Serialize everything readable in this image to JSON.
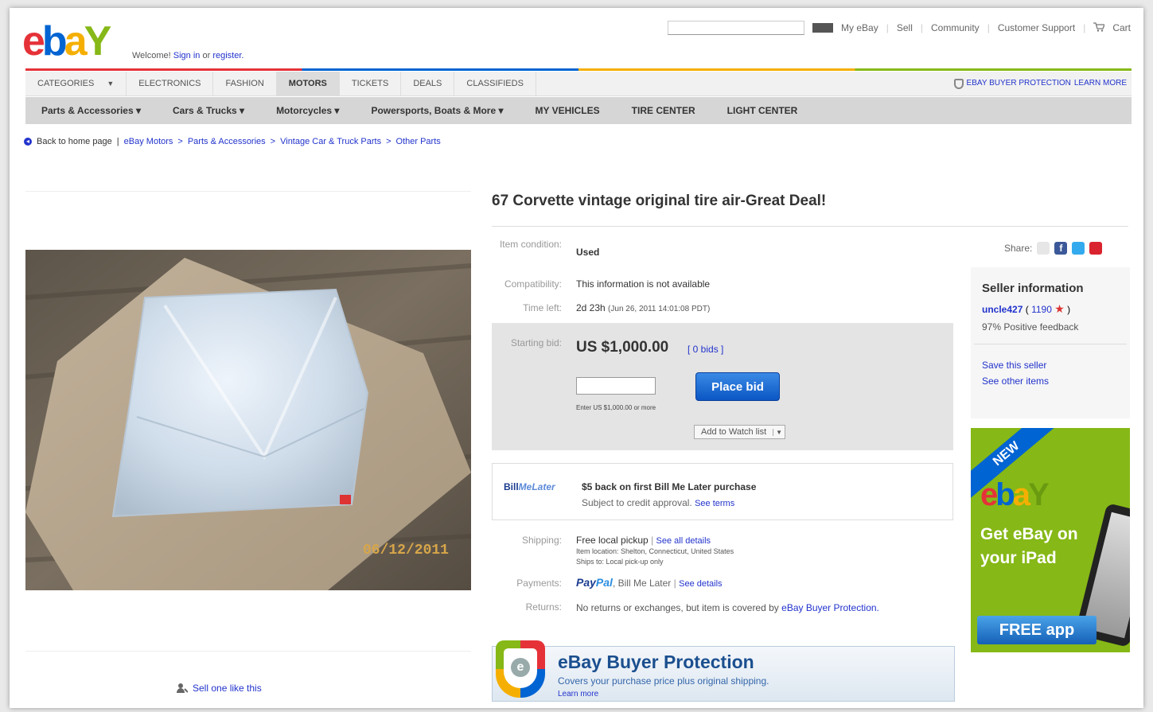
{
  "header": {
    "logo_letters": [
      "e",
      "b",
      "a",
      "Y"
    ],
    "welcome": "Welcome!",
    "sign_in": "Sign in",
    "or": "or",
    "register": "register.",
    "topnav": [
      "My eBay",
      "Sell",
      "Community",
      "Customer Support",
      "Cart"
    ]
  },
  "tabs": [
    "CATEGORIES",
    "ELECTRONICS",
    "FASHION",
    "MOTORS",
    "TICKETS",
    "DEALS",
    "CLASSIFIEDS"
  ],
  "active_tab": "MOTORS",
  "buyer_protection_top": "eBay Buyer Protection",
  "learn_more_top": "Learn more",
  "subnav": [
    "Parts & Accessories ▾",
    "Cars & Trucks ▾",
    "Motorcycles ▾",
    "Powersports, Boats & More ▾",
    "MY VEHICLES",
    "TIRE CENTER",
    "LIGHT CENTER"
  ],
  "breadcrumb": {
    "back": "Back to home page",
    "sep": "|",
    "path": [
      "eBay Motors",
      "Parts & Accessories",
      "Vintage Car & Truck Parts",
      "Other Parts"
    ]
  },
  "photo": {
    "date_stamp": "06/12/2011"
  },
  "sell_one": "Sell one like this",
  "item": {
    "title": "67 Corvette vintage original tire air-Great Deal!",
    "condition_label": "Item condition:",
    "condition": "Used",
    "compat_label": "Compatibility:",
    "compat": "This information is not available",
    "time_left_label": "Time left:",
    "time_left": "2d 23h",
    "time_left_detail": "(Jun 26, 2011 14:01:08 PDT)"
  },
  "bid": {
    "label": "Starting bid:",
    "price": "US $1,000.00",
    "bids_link": "[ 0 bids ]",
    "place_bid": "Place bid",
    "enter_hint": "Enter US $1,000.00 or more",
    "watch": "Add to Watch list"
  },
  "bill_me_later": {
    "logo_a": "Bill",
    "logo_b": "MeLater",
    "offer": "$5 back on first Bill Me Later purchase",
    "subject": "Subject to credit approval.",
    "see_terms": "See terms"
  },
  "shipping": {
    "label": "Shipping:",
    "value": "Free local pickup",
    "see_details": "See all details",
    "location": "Item location: Shelton, Connecticut, United States",
    "ships_to": "Ships to: Local pick-up only"
  },
  "payments": {
    "label": "Payments:",
    "paypal_a": "Pay",
    "paypal_b": "Pal",
    "bml": ", Bill Me Later",
    "see_details": "See details"
  },
  "returns": {
    "label": "Returns:",
    "text": "No returns or exchanges, but item is covered by",
    "link": "eBay Buyer Protection."
  },
  "protection_banner": {
    "title": "eBay Buyer Protection",
    "sub": "Covers your purchase price plus original shipping.",
    "learn": "Learn more"
  },
  "share_label": "Share:",
  "seller": {
    "heading": "Seller information",
    "name": "uncle427",
    "feedback_open": "(",
    "feedback_count": "1190",
    "feedback_close": ")",
    "positive": "97% Positive feedback",
    "save": "Save this seller",
    "see_other": "See other items"
  },
  "ad": {
    "ribbon": "NEW",
    "line1": "Get eBay on",
    "line2": "your iPad",
    "cta": "FREE app"
  },
  "colors": {
    "ebay_red": "#e53238",
    "ebay_blue": "#0064d2",
    "ebay_yellow": "#f5af02",
    "ebay_green": "#86b817",
    "link": "#2233cc"
  }
}
